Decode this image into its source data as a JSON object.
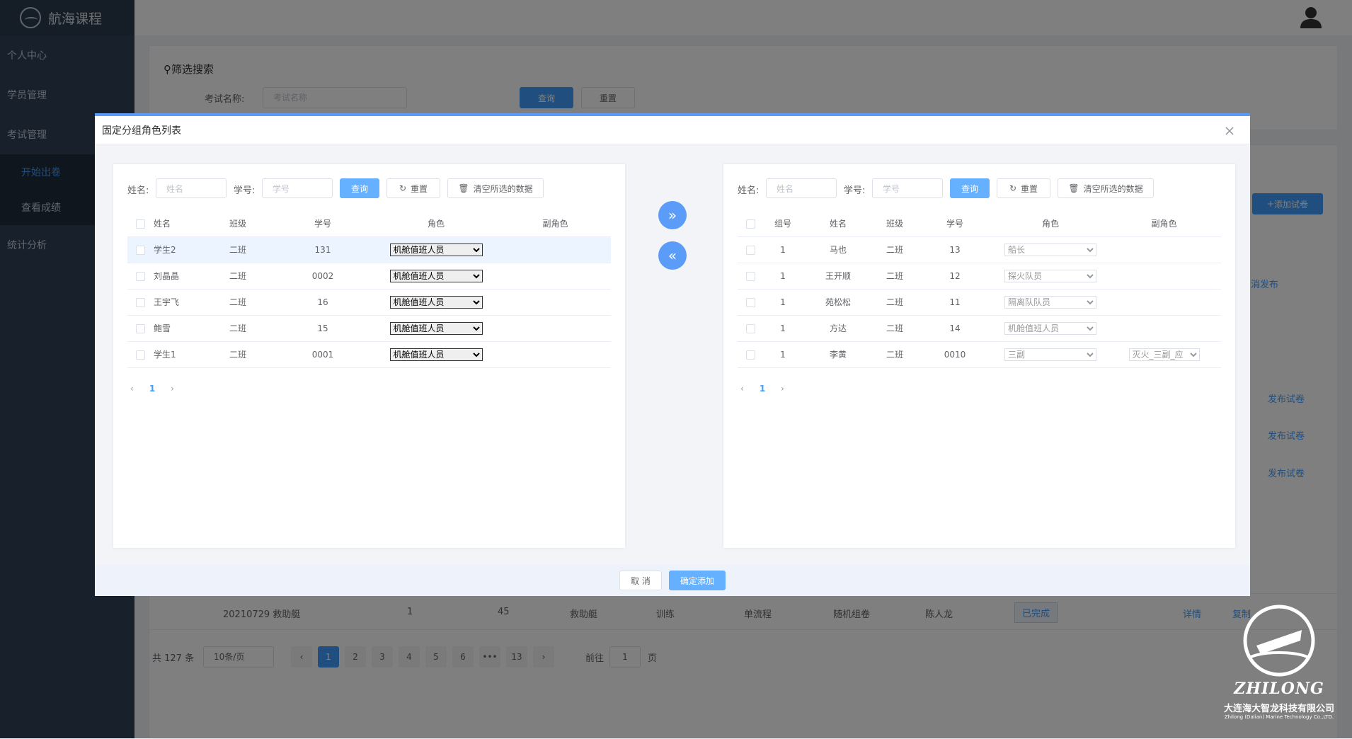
{
  "app": {
    "title": "航海课程"
  },
  "sidebar": {
    "items": [
      {
        "label": "个人中心"
      },
      {
        "label": "学员管理"
      },
      {
        "label": "考试管理"
      },
      {
        "label": "开始出卷"
      },
      {
        "label": "查看成绩"
      },
      {
        "label": "统计分析"
      }
    ]
  },
  "filter": {
    "title": "筛选搜索",
    "exam_label": "考试名称:",
    "exam_placeholder": "考试名称",
    "query_label": "查询",
    "reset_label": "重置"
  },
  "bg": {
    "add_paper": "添加试卷",
    "cancel_publish": "消发布",
    "publish_label": "发布试卷",
    "row": {
      "name": "20210729 救助艇",
      "c1": "1",
      "c2": "45",
      "c3": "救助艇",
      "c4": "训练",
      "c5": "单流程",
      "c6": "随机组卷",
      "c7": "陈人龙",
      "status": "已完成",
      "detail": "详情",
      "copy": "复制"
    },
    "pager": {
      "total": "共 127 条",
      "size": "10条/页",
      "pages": [
        "1",
        "2",
        "3",
        "4",
        "5",
        "6",
        "•••",
        "13"
      ],
      "goto": "前往",
      "goto_value": "1",
      "page_unit": "页"
    }
  },
  "dialog": {
    "title": "固定分组角色列表",
    "left": {
      "name_label": "姓名:",
      "name_placeholder": "姓名",
      "id_label": "学号:",
      "id_placeholder": "学号",
      "query": "查询",
      "reset": "重置",
      "clear": "清空所选的数据",
      "columns": [
        "姓名",
        "班级",
        "学号",
        "角色",
        "副角色"
      ],
      "rows": [
        {
          "name": "学生2",
          "class": "二班",
          "id": "131",
          "role": "机舱值班人员",
          "sub": ""
        },
        {
          "name": "刘晶晶",
          "class": "二班",
          "id": "0002",
          "role": "机舱值班人员",
          "sub": ""
        },
        {
          "name": "王宇飞",
          "class": "二班",
          "id": "16",
          "role": "机舱值班人员",
          "sub": ""
        },
        {
          "name": "鲍雪",
          "class": "二班",
          "id": "15",
          "role": "机舱值班人员",
          "sub": ""
        },
        {
          "name": "学生1",
          "class": "二班",
          "id": "0001",
          "role": "机舱值班人员",
          "sub": ""
        }
      ],
      "page": "1"
    },
    "right": {
      "name_label": "姓名:",
      "name_placeholder": "姓名",
      "id_label": "学号:",
      "id_placeholder": "学号",
      "query": "查询",
      "reset": "重置",
      "clear": "清空所选的数据",
      "columns": [
        "组号",
        "姓名",
        "班级",
        "学号",
        "角色",
        "副角色"
      ],
      "rows": [
        {
          "group": "1",
          "name": "马也",
          "class": "二班",
          "id": "13",
          "role": "船长",
          "sub": ""
        },
        {
          "group": "1",
          "name": "王开顺",
          "class": "二班",
          "id": "12",
          "role": "探火队员",
          "sub": ""
        },
        {
          "group": "1",
          "name": "苑松松",
          "class": "二班",
          "id": "11",
          "role": "隔离队队员",
          "sub": ""
        },
        {
          "group": "1",
          "name": "方达",
          "class": "二班",
          "id": "14",
          "role": "机舱值班人员",
          "sub": ""
        },
        {
          "group": "1",
          "name": "李黄",
          "class": "二班",
          "id": "0010",
          "role": "三副",
          "sub": "灭火_三副_应"
        }
      ],
      "page": "1"
    },
    "cancel": "取 消",
    "confirm": "确定添加"
  },
  "watermark": {
    "brand": "ZHILONG",
    "company": "大连海大智龙科技有限公司",
    "company_en": "Zhilong (Dalian) Marine Technology Co.,LTD."
  }
}
